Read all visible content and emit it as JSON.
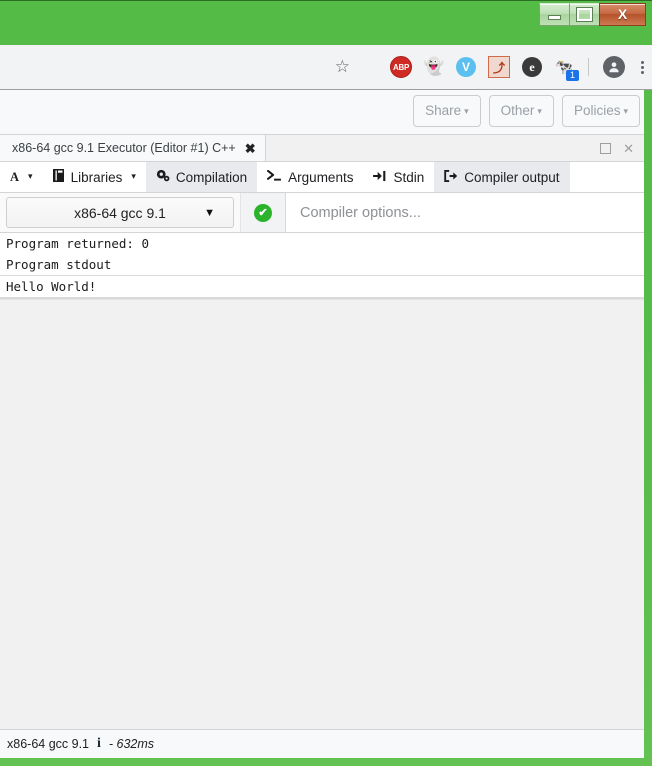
{
  "window": {
    "controls": {
      "minimize_label": "–",
      "maximize_label": "□",
      "close_label": "X"
    }
  },
  "browser": {
    "omnibox": {
      "value": "",
      "placeholder": ""
    },
    "star_icon": "☆",
    "extensions": [
      {
        "name": "adblock-plus-icon",
        "label": "ABP"
      },
      {
        "name": "ghostery-icon",
        "label": "👻"
      },
      {
        "name": "vt-shield-icon",
        "label": "V"
      },
      {
        "name": "adobe-pdf-icon",
        "label": "⤴"
      },
      {
        "name": "evernote-icon",
        "label": "e"
      },
      {
        "name": "cow-extension-icon",
        "label": "🐄",
        "badge": "1"
      }
    ],
    "profile_icon": "●",
    "menu_icon": "kebab-menu"
  },
  "page": {
    "top_nav": [
      {
        "label": "Share",
        "caret": "▾"
      },
      {
        "label": "Other",
        "caret": "▾"
      },
      {
        "label": "Policies",
        "caret": "▾"
      }
    ]
  },
  "pane": {
    "title": "x86-64 gcc 9.1 Executor (Editor #1) C++",
    "close_label": "✖",
    "maximize_label": "",
    "window_close_label": "✕"
  },
  "tool_tabs": [
    {
      "name": "font-size",
      "icon": "A",
      "label": "",
      "caret": "▾",
      "active": false
    },
    {
      "name": "libraries",
      "icon": "📕",
      "label": "Libraries",
      "caret": "▾",
      "active": false
    },
    {
      "name": "compilation",
      "icon": "⚙",
      "label": "Compilation",
      "caret": "",
      "active": true
    },
    {
      "name": "arguments",
      "icon": "➤_",
      "label": "Arguments",
      "caret": "",
      "active": false
    },
    {
      "name": "stdin",
      "icon": "⇥",
      "label": "Stdin",
      "caret": "",
      "active": false
    },
    {
      "name": "compiler-output",
      "icon": "↪",
      "label": "Compiler output",
      "caret": "",
      "active": true
    }
  ],
  "compiler": {
    "selected": "x86-64 gcc 9.1",
    "caret": "▼",
    "status_icon": "✔",
    "options_value": "",
    "options_placeholder": "Compiler options..."
  },
  "output": {
    "lines": [
      {
        "text": "Program returned: 0",
        "boxed": false
      },
      {
        "text": "Program stdout",
        "boxed": false
      },
      {
        "text": "Hello World!",
        "boxed": true
      }
    ]
  },
  "status_bar": {
    "compiler": "x86-64 gcc 9.1",
    "info_icon": "i",
    "time": "- 632ms"
  },
  "colors": {
    "frame_green": "#57bd48",
    "accent_blue": "#1a73e8",
    "success_green": "#2bb32b",
    "tab_active_bg": "#e8eaed"
  }
}
